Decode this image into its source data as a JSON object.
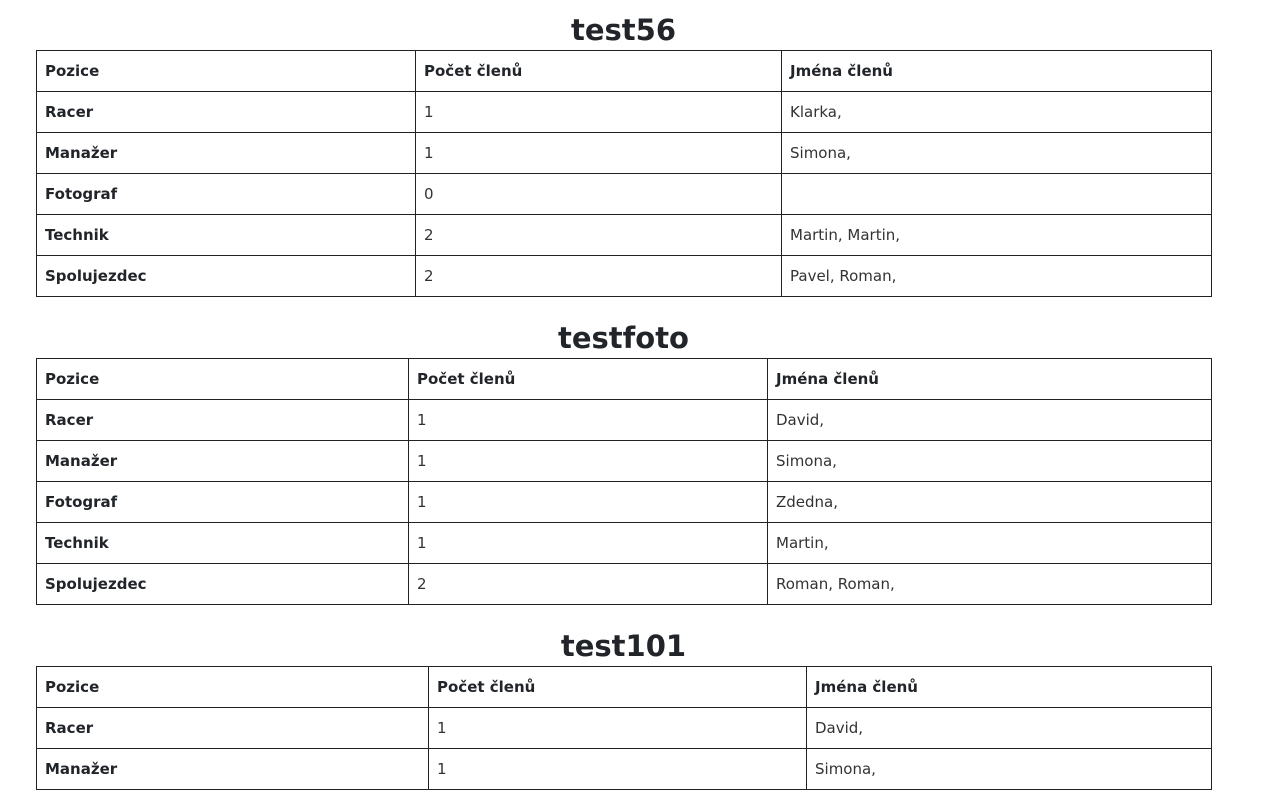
{
  "headers": {
    "position": "Pozice",
    "count": "Počet členů",
    "names": "Jména členů"
  },
  "teams": [
    {
      "name": "test56",
      "rows": [
        {
          "position": "Racer",
          "count": "1",
          "names": "Klarka,"
        },
        {
          "position": "Manažer",
          "count": "1",
          "names": "Simona,"
        },
        {
          "position": "Fotograf",
          "count": "0",
          "names": ""
        },
        {
          "position": "Technik",
          "count": "2",
          "names": "Martin, Martin,"
        },
        {
          "position": "Spolujezdec",
          "count": "2",
          "names": "Pavel, Roman,"
        }
      ]
    },
    {
      "name": "testfoto",
      "rows": [
        {
          "position": "Racer",
          "count": "1",
          "names": "David,"
        },
        {
          "position": "Manažer",
          "count": "1",
          "names": "Simona,"
        },
        {
          "position": "Fotograf",
          "count": "1",
          "names": "Zdedna,"
        },
        {
          "position": "Technik",
          "count": "1",
          "names": "Martin,"
        },
        {
          "position": "Spolujezdec",
          "count": "2",
          "names": "Roman, Roman,"
        }
      ]
    },
    {
      "name": "test101",
      "rows": [
        {
          "position": "Racer",
          "count": "1",
          "names": "David,"
        },
        {
          "position": "Manažer",
          "count": "1",
          "names": "Simona,"
        }
      ]
    }
  ]
}
